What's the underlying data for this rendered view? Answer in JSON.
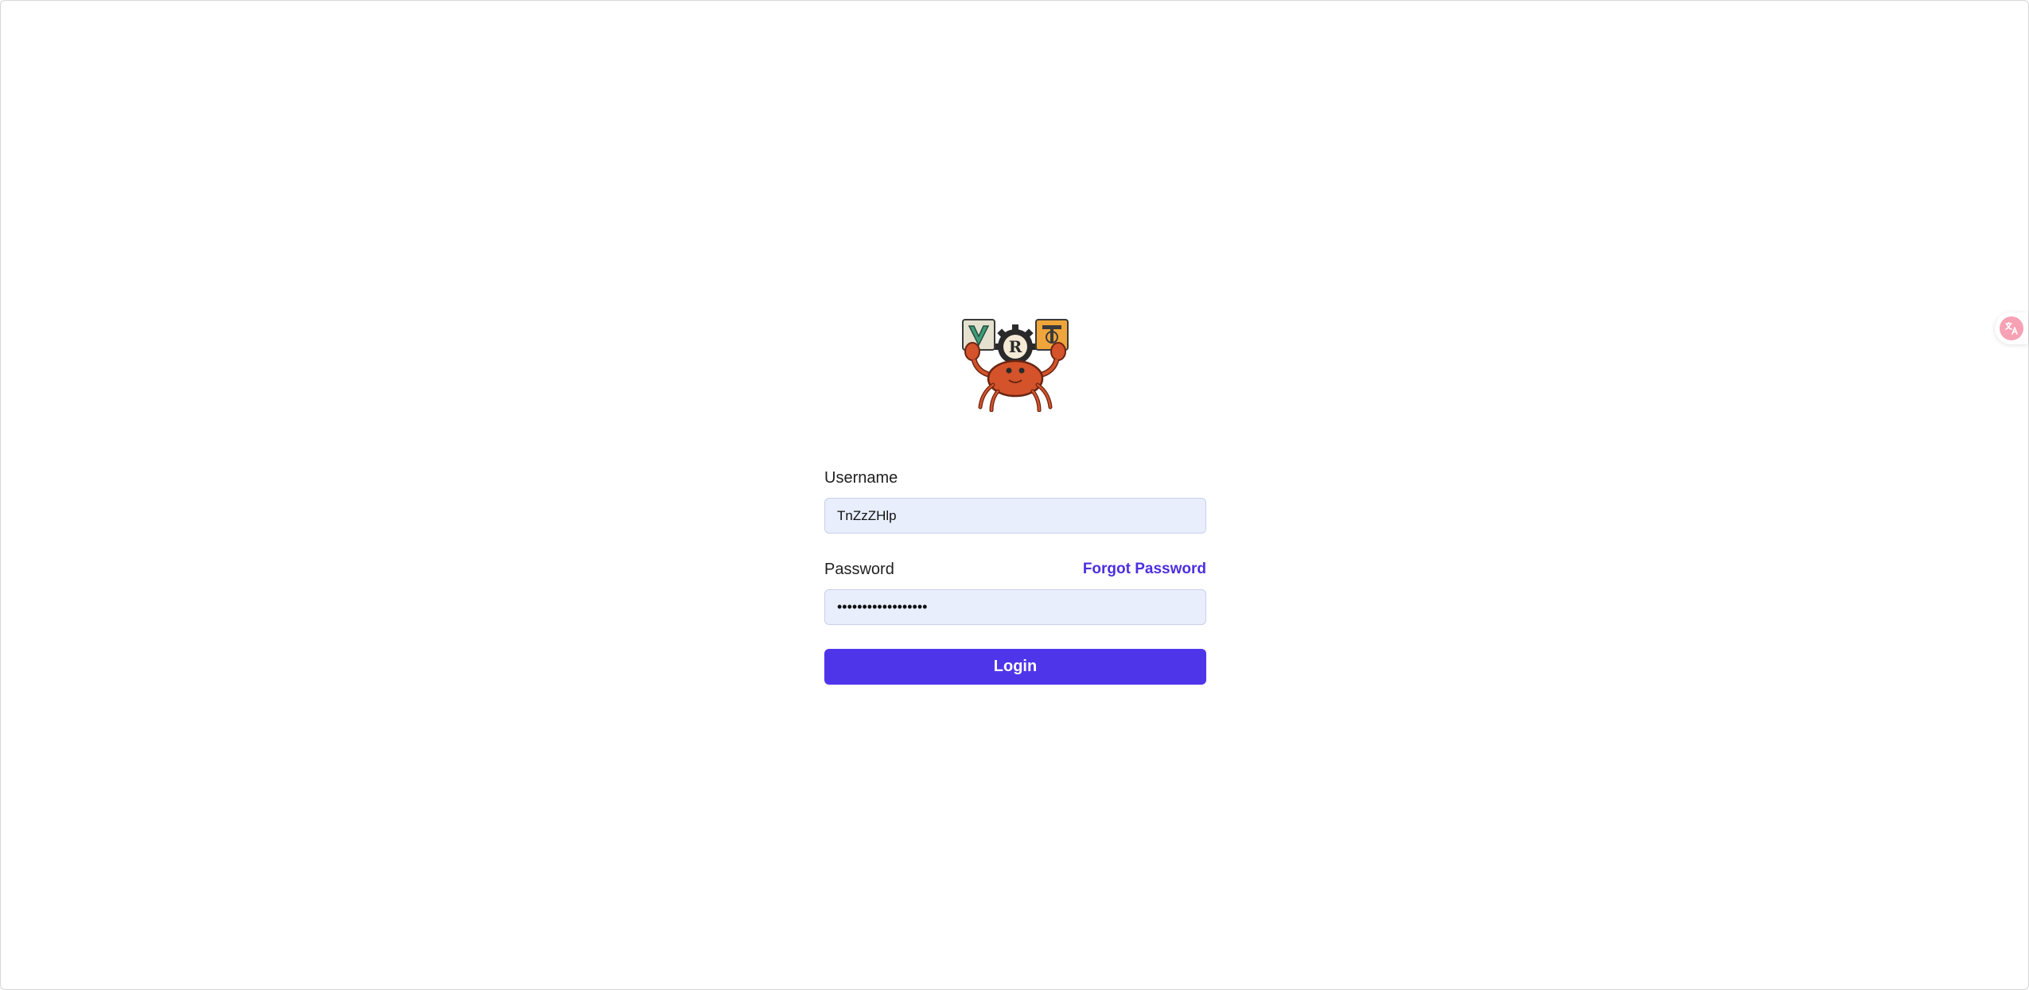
{
  "login_form": {
    "username_label": "Username",
    "username_value": "TnZzZHlp",
    "password_label": "Password",
    "password_value": "••••••••••••••••••",
    "forgot_password_label": "Forgot Password",
    "login_button_label": "Login"
  },
  "logo": {
    "icon": "crab-mascot-logo",
    "sign_letters": [
      "V",
      "R",
      "T"
    ]
  },
  "translate_widget": {
    "icon": "translate-icon"
  },
  "colors": {
    "accent": "#4f35ea",
    "link": "#4b2fe0",
    "input_bg": "#e8eefc",
    "crab": "#d4532a"
  }
}
